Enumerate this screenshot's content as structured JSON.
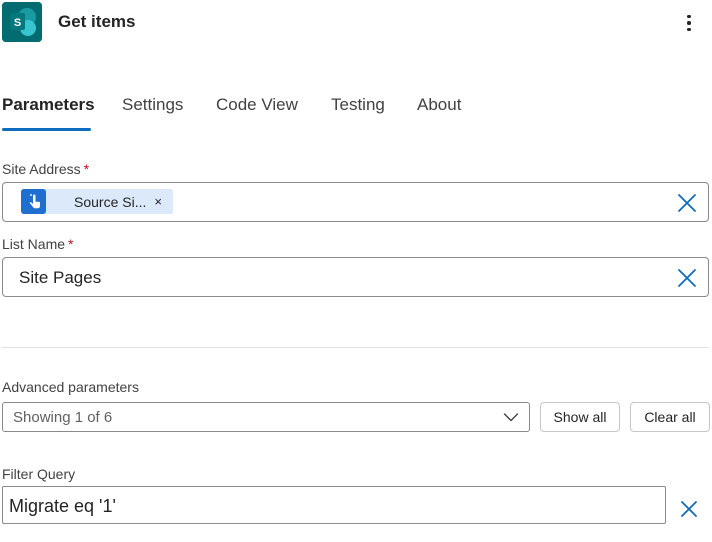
{
  "header": {
    "app_icon": "sharepoint-icon",
    "app_icon_letter": "S",
    "title": "Get items",
    "more_icon": "more-vertical-icon"
  },
  "tabs": [
    {
      "label": "Parameters",
      "active": true
    },
    {
      "label": "Settings",
      "active": false
    },
    {
      "label": "Code View",
      "active": false
    },
    {
      "label": "Testing",
      "active": false
    },
    {
      "label": "About",
      "active": false
    }
  ],
  "fields": {
    "site_address": {
      "label": "Site Address",
      "required_mark": "*",
      "token": {
        "label": "Source Si...",
        "icon": "trigger-touch-icon",
        "remove_glyph": "×"
      },
      "clear_icon": "close-icon"
    },
    "list_name": {
      "label": "List Name",
      "required_mark": "*",
      "value": "Site Pages",
      "clear_icon": "close-icon"
    }
  },
  "advanced": {
    "label": "Advanced parameters",
    "dropdown_value": "Showing 1 of 6",
    "dropdown_icon": "chevron-down-icon",
    "show_all_label": "Show all",
    "clear_all_label": "Clear all"
  },
  "filter_query": {
    "label": "Filter Query",
    "value": "Migrate eq '1'",
    "clear_icon": "close-icon"
  },
  "colors": {
    "accent": "#0f6cbd",
    "sharepoint": "#036c70",
    "token_bg": "#dbe9fb",
    "required": "#c50f1f"
  }
}
